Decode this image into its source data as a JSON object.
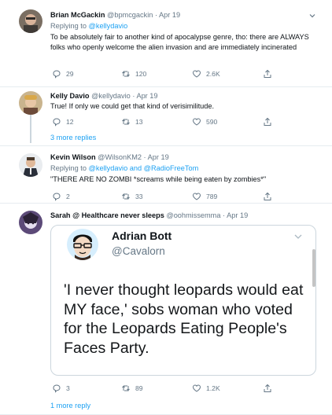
{
  "tweets": [
    {
      "name": "Brian McGackin",
      "handle": "@bpmcgackin",
      "date": "Apr 19",
      "replying_prefix": "Replying to",
      "replying_to": "@kellydavio",
      "text": "To be absolutely fair to another kind of apocalypse genre, tho: there are ALWAYS folks who openly welcome the alien invasion and are immediately incinerated",
      "replies": "29",
      "retweets": "120",
      "likes": "2.6K"
    },
    {
      "name": "Kelly Davio",
      "handle": "@kellydavio",
      "date": "Apr 19",
      "text": "True! If only we could get that kind of verisimilitude.",
      "replies": "12",
      "retweets": "13",
      "likes": "590",
      "more_replies": "3 more replies"
    },
    {
      "name": "Kevin Wilson",
      "handle": "@WilsonKM2",
      "date": "Apr 19",
      "replying_prefix": "Replying to",
      "replying_to": "@kellydavio",
      "replying_and": "and",
      "replying_to_2": "@RadioFreeTom",
      "text": "\"THERE ARE NO ZOMBI *screams while being eaten by zombies*\"",
      "replies": "2",
      "retweets": "33",
      "likes": "789"
    },
    {
      "name": "Sarah @ Healthcare never sleeps",
      "handle": "@oohmissemma",
      "date": "Apr 19",
      "replies": "3",
      "retweets": "89",
      "likes": "1.2K",
      "more_replies": "1 more reply",
      "embed": {
        "name": "Adrian Bott",
        "handle": "@Cavalorn",
        "text": "'I never thought leopards would eat MY face,' sobs woman who voted for the Leopards Eating People's Faces Party."
      }
    }
  ],
  "colors": {
    "link": "#1da1f2",
    "muted": "#657786",
    "divider": "#e6ecf0",
    "thread_line": "#ccd6dd"
  },
  "icons": [
    "reply-icon",
    "retweet-icon",
    "like-icon",
    "share-icon",
    "chevron-down-icon"
  ]
}
